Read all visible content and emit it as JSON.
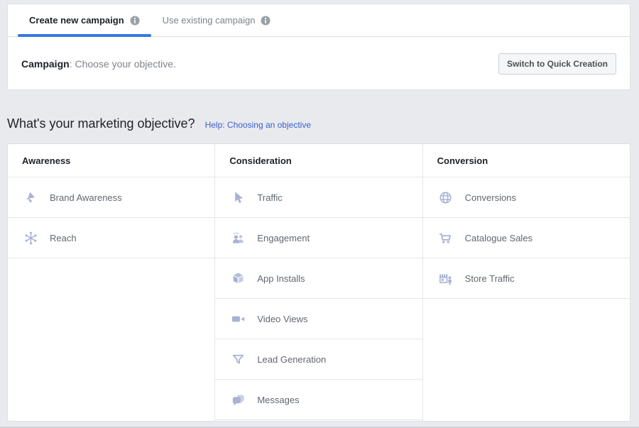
{
  "tabs": [
    {
      "label": "Create new campaign",
      "active": true
    },
    {
      "label": "Use existing campaign",
      "active": false
    }
  ],
  "campaign_header": {
    "title": "Campaign",
    "subtitle": ": Choose your objective.",
    "switch_button_label": "Switch to Quick Creation"
  },
  "objective_section": {
    "heading": "What's your marketing objective?",
    "help_link": "Help: Choosing an objective"
  },
  "objectives": {
    "columns": [
      {
        "title": "Awareness",
        "items": [
          {
            "label": "Brand Awareness",
            "icon": "megaphone-icon"
          },
          {
            "label": "Reach",
            "icon": "reach-icon"
          }
        ]
      },
      {
        "title": "Consideration",
        "items": [
          {
            "label": "Traffic",
            "icon": "cursor-icon"
          },
          {
            "label": "Engagement",
            "icon": "people-icon"
          },
          {
            "label": "App Installs",
            "icon": "cube-icon"
          },
          {
            "label": "Video Views",
            "icon": "video-camera-icon"
          },
          {
            "label": "Lead Generation",
            "icon": "funnel-icon"
          },
          {
            "label": "Messages",
            "icon": "chat-bubbles-icon"
          }
        ]
      },
      {
        "title": "Conversion",
        "items": [
          {
            "label": "Conversions",
            "icon": "globe-icon"
          },
          {
            "label": "Catalogue Sales",
            "icon": "cart-icon"
          },
          {
            "label": "Store Traffic",
            "icon": "storefront-icon"
          }
        ]
      }
    ]
  },
  "colors": {
    "accent_blue": "#3578e5",
    "link_blue": "#3a5fcf",
    "icon_lavender": "#a8b1d6",
    "page_background": "#e9eaed"
  }
}
